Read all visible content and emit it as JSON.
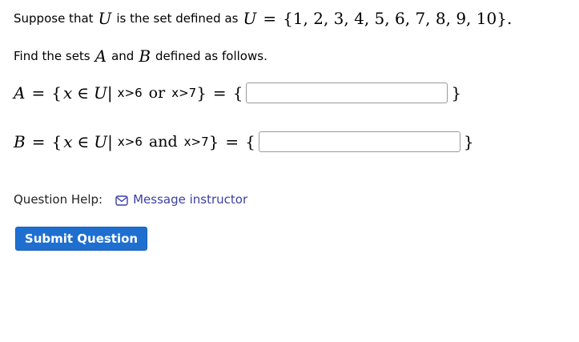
{
  "intro": {
    "prefix": "Suppose that",
    "var_U": "U",
    "middle": "is the set defined as",
    "var_U2": "U",
    "equals": "=",
    "set": "{1, 2, 3, 4, 5, 6, 7, 8, 9, 10}",
    "period": "."
  },
  "instruction": {
    "prefix": "Find the sets",
    "var_A": "A",
    "and": "and",
    "var_B": "B",
    "suffix": "defined as follows."
  },
  "set_A": {
    "name": "A",
    "eq": "=",
    "open": "{",
    "var_x": "x",
    "in": "∈",
    "var_U": "U",
    "bar": "|",
    "cond1": "x>6",
    "connector": "or",
    "cond2": "x>7",
    "close": "}",
    "eq2": "=",
    "open2": "{",
    "value": "",
    "close2": "}"
  },
  "set_B": {
    "name": "B",
    "eq": "=",
    "open": "{",
    "var_x": "x",
    "in": "∈",
    "var_U": "U",
    "bar": "|",
    "cond1": "x>6",
    "connector": "and",
    "cond2": "x>7",
    "close": "}",
    "eq2": "=",
    "open2": "{",
    "value": "",
    "close2": "}"
  },
  "help": {
    "label": "Question Help:",
    "icon": "envelope-icon",
    "link_text": "Message instructor",
    "link_color": "#3b3fa6"
  },
  "submit": {
    "label": "Submit Question",
    "color": "#1f6fd1"
  }
}
